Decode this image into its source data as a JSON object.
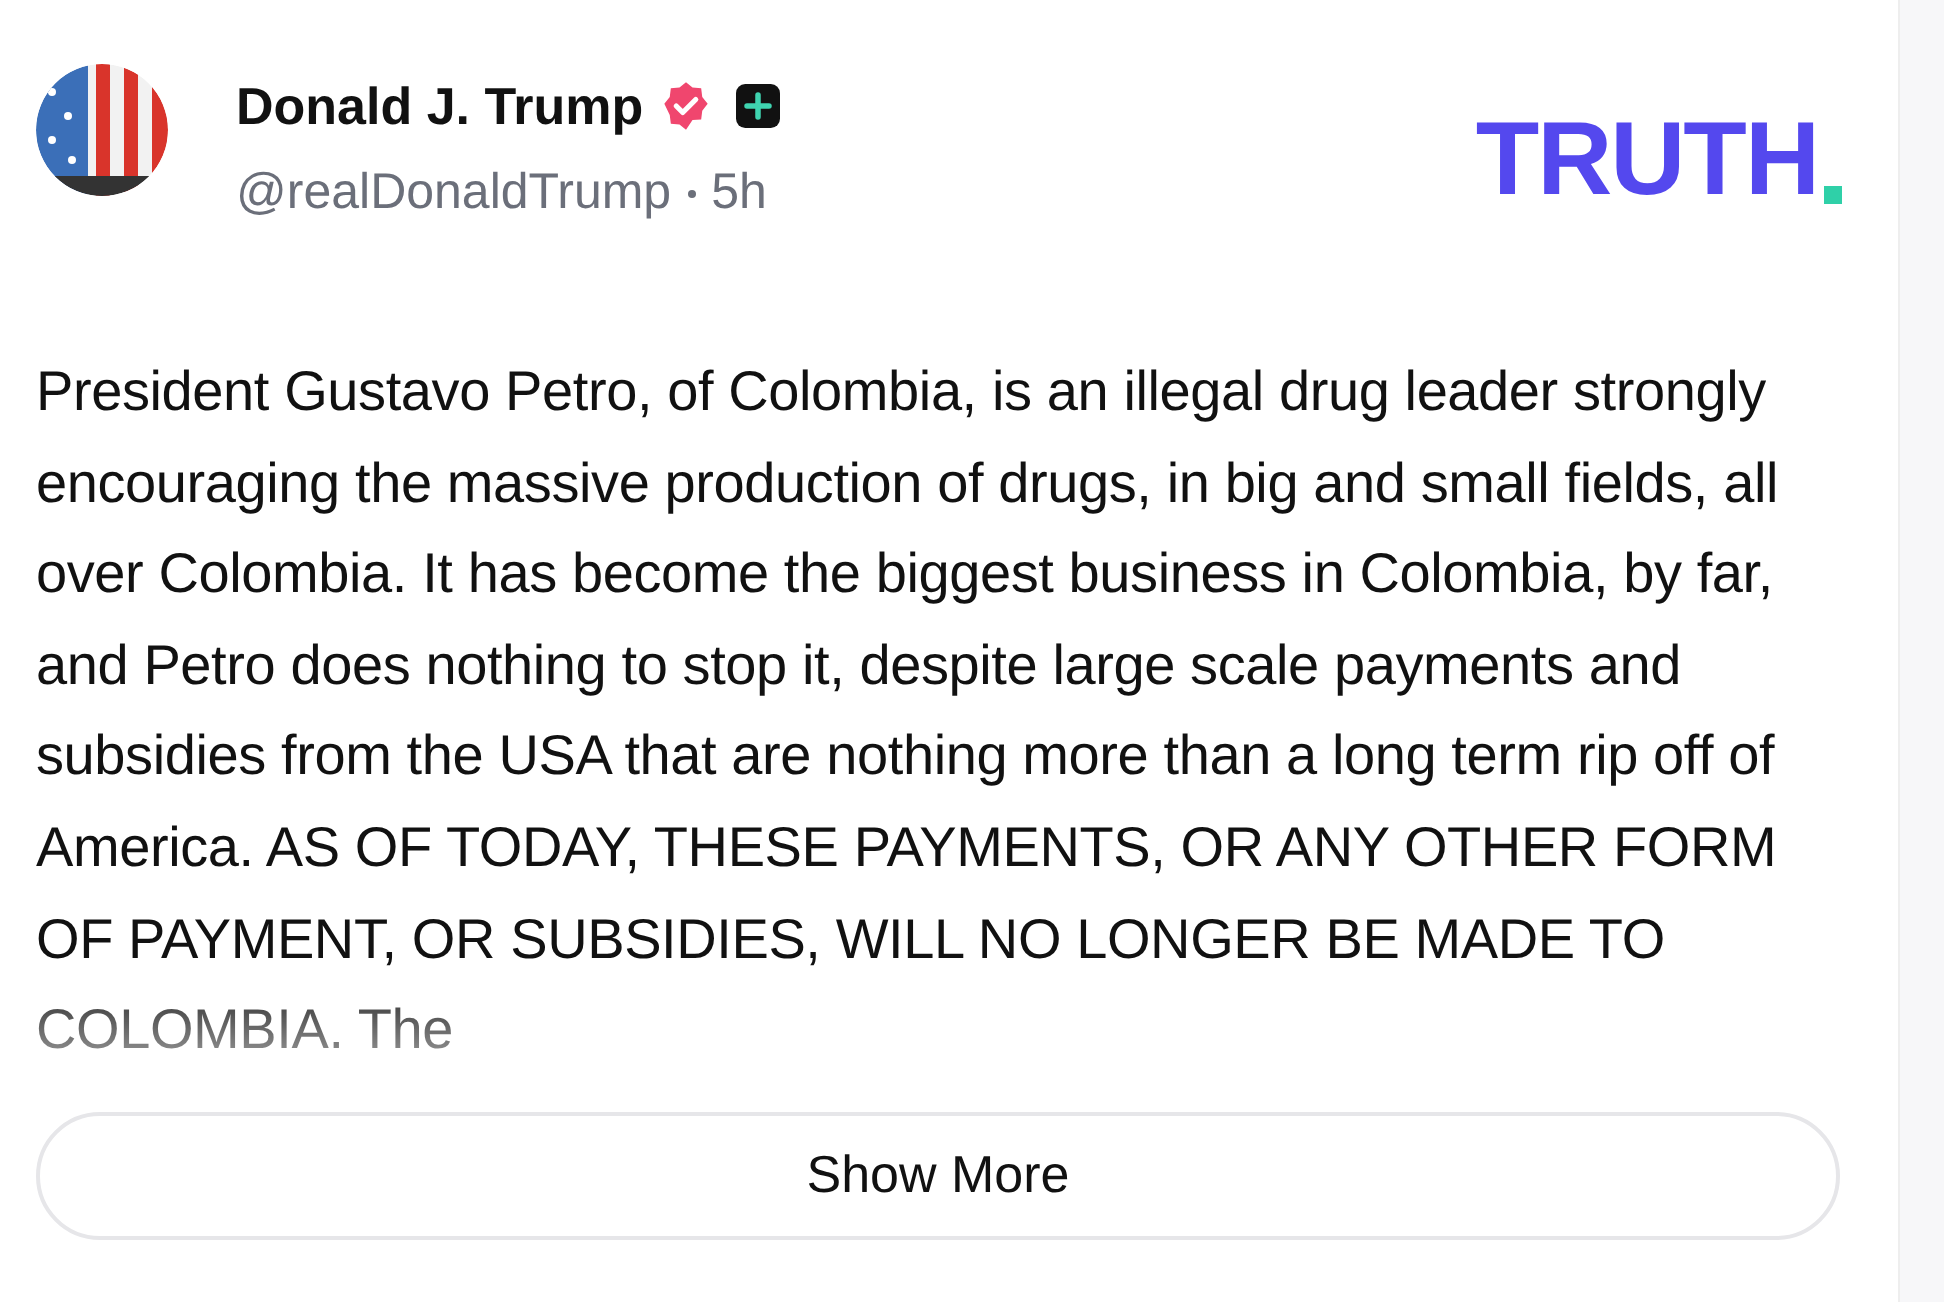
{
  "post": {
    "author": {
      "name": "Donald J. Trump",
      "verified": true,
      "handle": "@realDonaldTrump",
      "time": "5h"
    },
    "logo": {
      "text": "TRUTH"
    },
    "body": "President Gustavo Petro, of Colombia, is an illegal drug leader strongly encouraging the massive production of drugs, in big and small fields, all over Colombia. It has become the biggest business in Colombia, by far, and Petro does nothing to stop it, despite large scale payments and subsidies from the USA that are nothing more than a long term rip off of America. AS OF TODAY, THESE PAYMENTS, OR ANY OTHER FORM OF PAYMENT, OR SUBSIDIES, WILL NO LONGER BE MADE TO COLOMBIA. The",
    "show_more": "Show More"
  }
}
